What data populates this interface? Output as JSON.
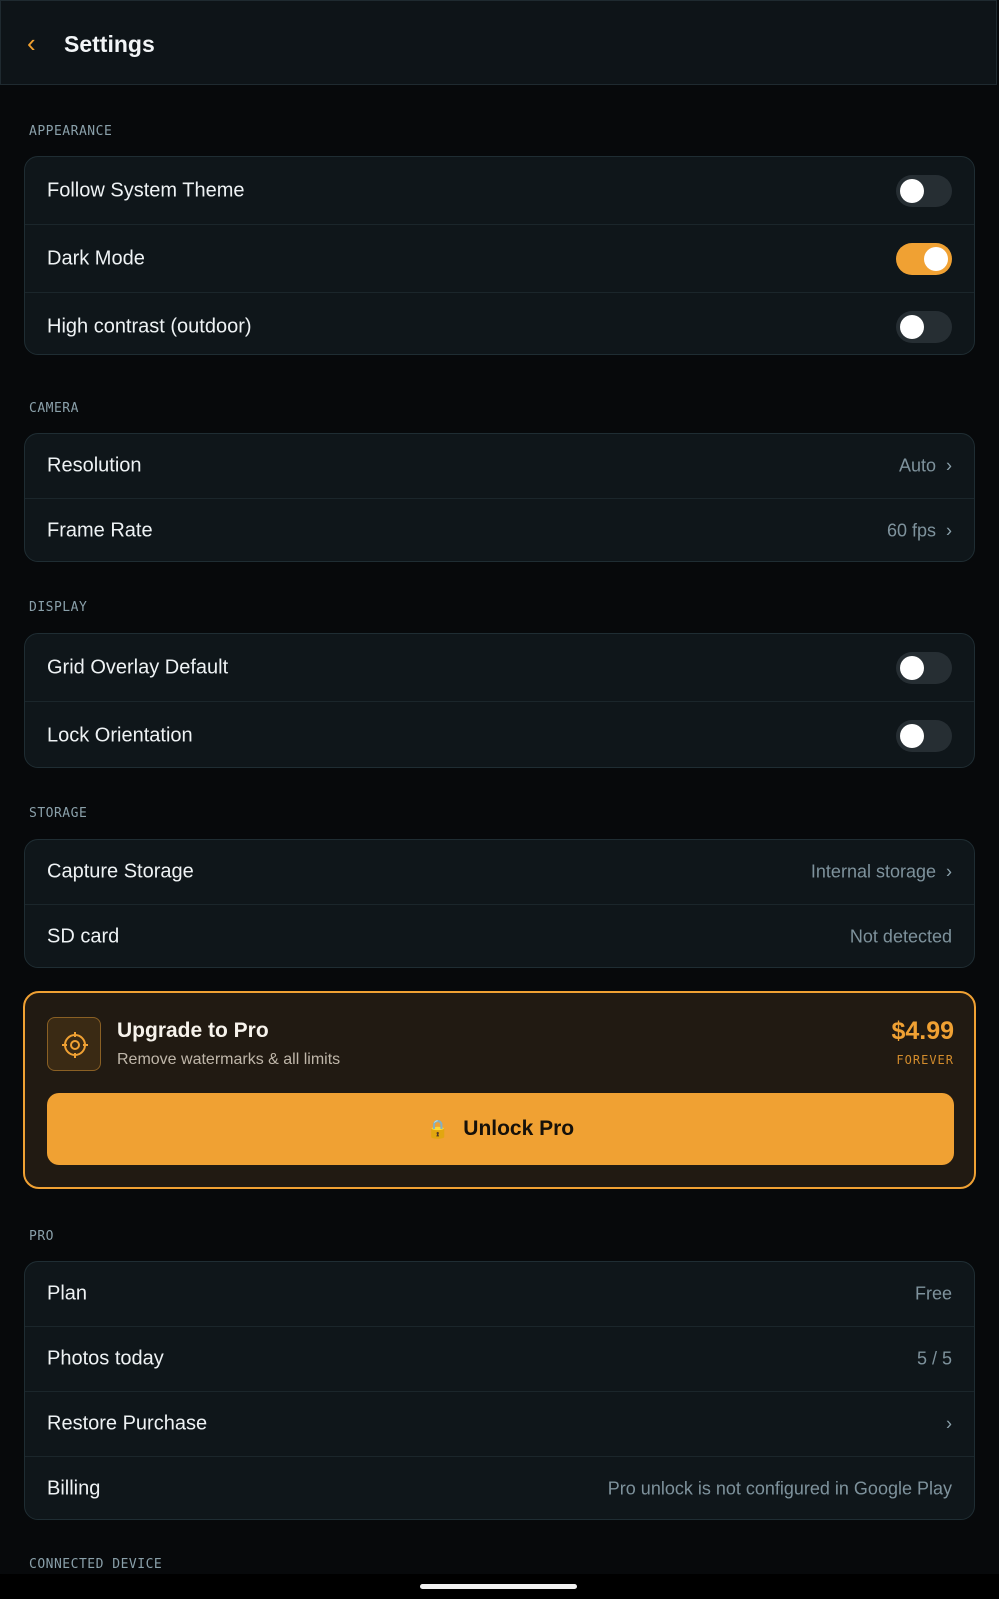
{
  "header": {
    "back_icon": "chevron-left-icon",
    "title": "Settings"
  },
  "sections": {
    "appearance": {
      "label": "APPEARANCE",
      "items": [
        {
          "label": "Follow System Theme",
          "toggle": false
        },
        {
          "label": "Dark Mode",
          "toggle": true
        },
        {
          "label": "High contrast (outdoor)",
          "toggle": false
        }
      ]
    },
    "camera": {
      "label": "CAMERA",
      "items": [
        {
          "label": "Resolution",
          "value": "Auto"
        },
        {
          "label": "Frame Rate",
          "value": "60 fps"
        }
      ]
    },
    "display": {
      "label": "DISPLAY",
      "items": [
        {
          "label": "Grid Overlay Default",
          "toggle": false
        },
        {
          "label": "Lock Orientation",
          "toggle": false
        }
      ]
    },
    "storage": {
      "label": "STORAGE",
      "items": [
        {
          "label": "Capture Storage",
          "value": "Internal storage"
        },
        {
          "label": "SD card",
          "value": "Not detected"
        }
      ]
    },
    "pro": {
      "label": "PRO",
      "items": [
        {
          "label": "Plan",
          "value": "Free"
        },
        {
          "label": "Photos today",
          "value": "5 / 5"
        },
        {
          "label": "Restore Purchase",
          "value": ""
        },
        {
          "label": "Billing",
          "value": "Pro unlock is not configured in Google Play"
        }
      ]
    },
    "connected": {
      "label": "CONNECTED DEVICE"
    }
  },
  "upgrade": {
    "icon": "crosshair-icon",
    "title": "Upgrade to Pro",
    "subtitle": "Remove watermarks & all limits",
    "price": "$4.99",
    "price_note": "FOREVER",
    "button_icon": "lock-icon",
    "button_label": "Unlock Pro"
  },
  "colors": {
    "accent": "#f0a133",
    "background": "#07090b",
    "card": "#0f161a"
  }
}
